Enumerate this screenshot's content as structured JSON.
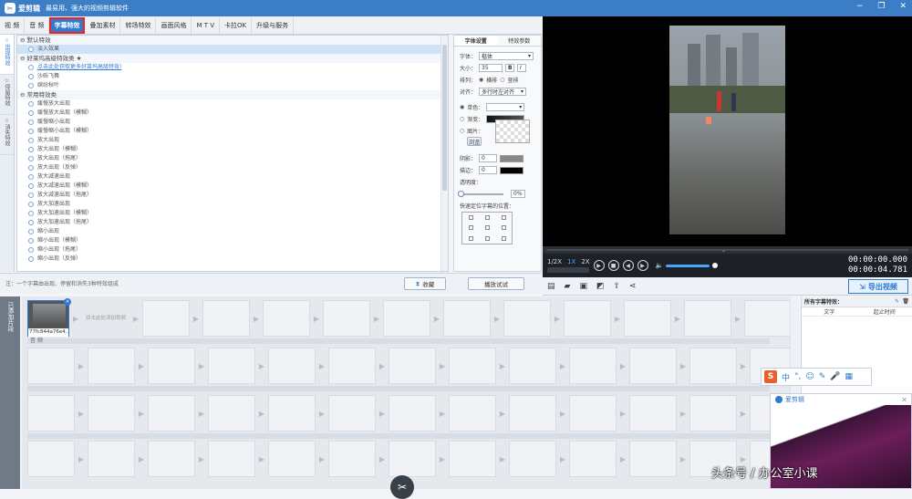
{
  "app": {
    "name": "爱剪辑",
    "slogan": "最易用、强大的视频剪辑软件"
  },
  "window_controls": [
    "−",
    "❐",
    "✕"
  ],
  "tabs": [
    {
      "label": "视  频"
    },
    {
      "label": "音  频"
    },
    {
      "label": "字幕特效",
      "active": true
    },
    {
      "label": "叠加素材"
    },
    {
      "label": "转场特效"
    },
    {
      "label": "画面风格"
    },
    {
      "label": "M T V"
    },
    {
      "label": "卡拉OK"
    },
    {
      "label": "升级与服务"
    }
  ],
  "side_tabs": [
    {
      "label": "出现特效",
      "active": true
    },
    {
      "label": "停留特效"
    },
    {
      "label": "消失特效"
    }
  ],
  "effects": {
    "groups": [
      {
        "label": "⊖ 默认特效",
        "items": [
          {
            "label": "淡入效果",
            "selected": true
          }
        ]
      },
      {
        "label": "⊖ 好莱坞高级特效类 ★",
        "items": [
          {
            "label": "点击此处获取更多好莱坞高级特效!",
            "link": true
          },
          {
            "label": "沙砾飞舞"
          },
          {
            "label": "缤纷秋叶"
          }
        ]
      },
      {
        "label": "⊖ 常用特效类",
        "items": [
          {
            "label": "缓慢放大出现"
          },
          {
            "label": "缓慢放大出现（模糊）"
          },
          {
            "label": "缓慢缩小出现"
          },
          {
            "label": "缓慢缩小出现（模糊）"
          },
          {
            "label": "放大出现"
          },
          {
            "label": "放大出现（模糊）"
          },
          {
            "label": "放大出现（拖尾）"
          },
          {
            "label": "放大出现（反弹）"
          },
          {
            "label": "放大减速出现"
          },
          {
            "label": "放大减速出现（模糊）"
          },
          {
            "label": "放大减速出现（拖尾）"
          },
          {
            "label": "放大加速出现"
          },
          {
            "label": "放大加速出现（模糊）"
          },
          {
            "label": "放大加速出现（拖尾）"
          },
          {
            "label": "缩小出现"
          },
          {
            "label": "缩小出现（模糊）"
          },
          {
            "label": "缩小出现（拖尾）"
          },
          {
            "label": "缩小出现（反弹）"
          }
        ]
      }
    ]
  },
  "hint": "注：一个字幕由出现、停留和消失3种特效组成",
  "collect_button": "收藏",
  "preview_button": "播放试试",
  "settings": {
    "tabs": [
      "字体设置",
      "特效参数"
    ],
    "font_label": "字体：",
    "font_value": "楷体",
    "size_label": "大小：",
    "size_value": "35",
    "bold": "B",
    "italic": "I",
    "direction_label": "排列：",
    "horizontal": "横排",
    "vertical": "竖排",
    "align_label": "对齐：",
    "align_value": "多行时左对齐",
    "solid_label": "单色：",
    "gradient_label": "渐变：",
    "image_label": "图片：",
    "browse": "浏览",
    "shadow_label": "阴影：",
    "shadow_value": "0",
    "border_label": "描边：",
    "border_value": "0",
    "opacity_label": "透明度：",
    "opacity_value": "0%",
    "position_label": "快速定位字幕的位置："
  },
  "player": {
    "speeds": [
      "1/2X",
      "1X",
      "2X"
    ],
    "current_time": "00:00:00.000",
    "total_time": "00:00:04.781",
    "progress": 0.0,
    "volume": 0.8
  },
  "toolbar": {
    "export_label": "导出视频"
  },
  "timeline": {
    "side_label": "已添加片段",
    "clip_name": "77fc844a76e4...",
    "add_hint": "双击此处添加视频",
    "audio_label": "音  频"
  },
  "subtitle_panel": {
    "title": "所有字幕特效：",
    "col_text": "文字",
    "col_time": "起止时间"
  },
  "ime": {
    "logo": "S",
    "items": [
      "中",
      "°,",
      "☺",
      "✎",
      "🎤",
      "▦"
    ]
  },
  "popup": {
    "title": "爱剪辑",
    "close": "✕"
  },
  "watermark": "头条号 / 办公室小课"
}
